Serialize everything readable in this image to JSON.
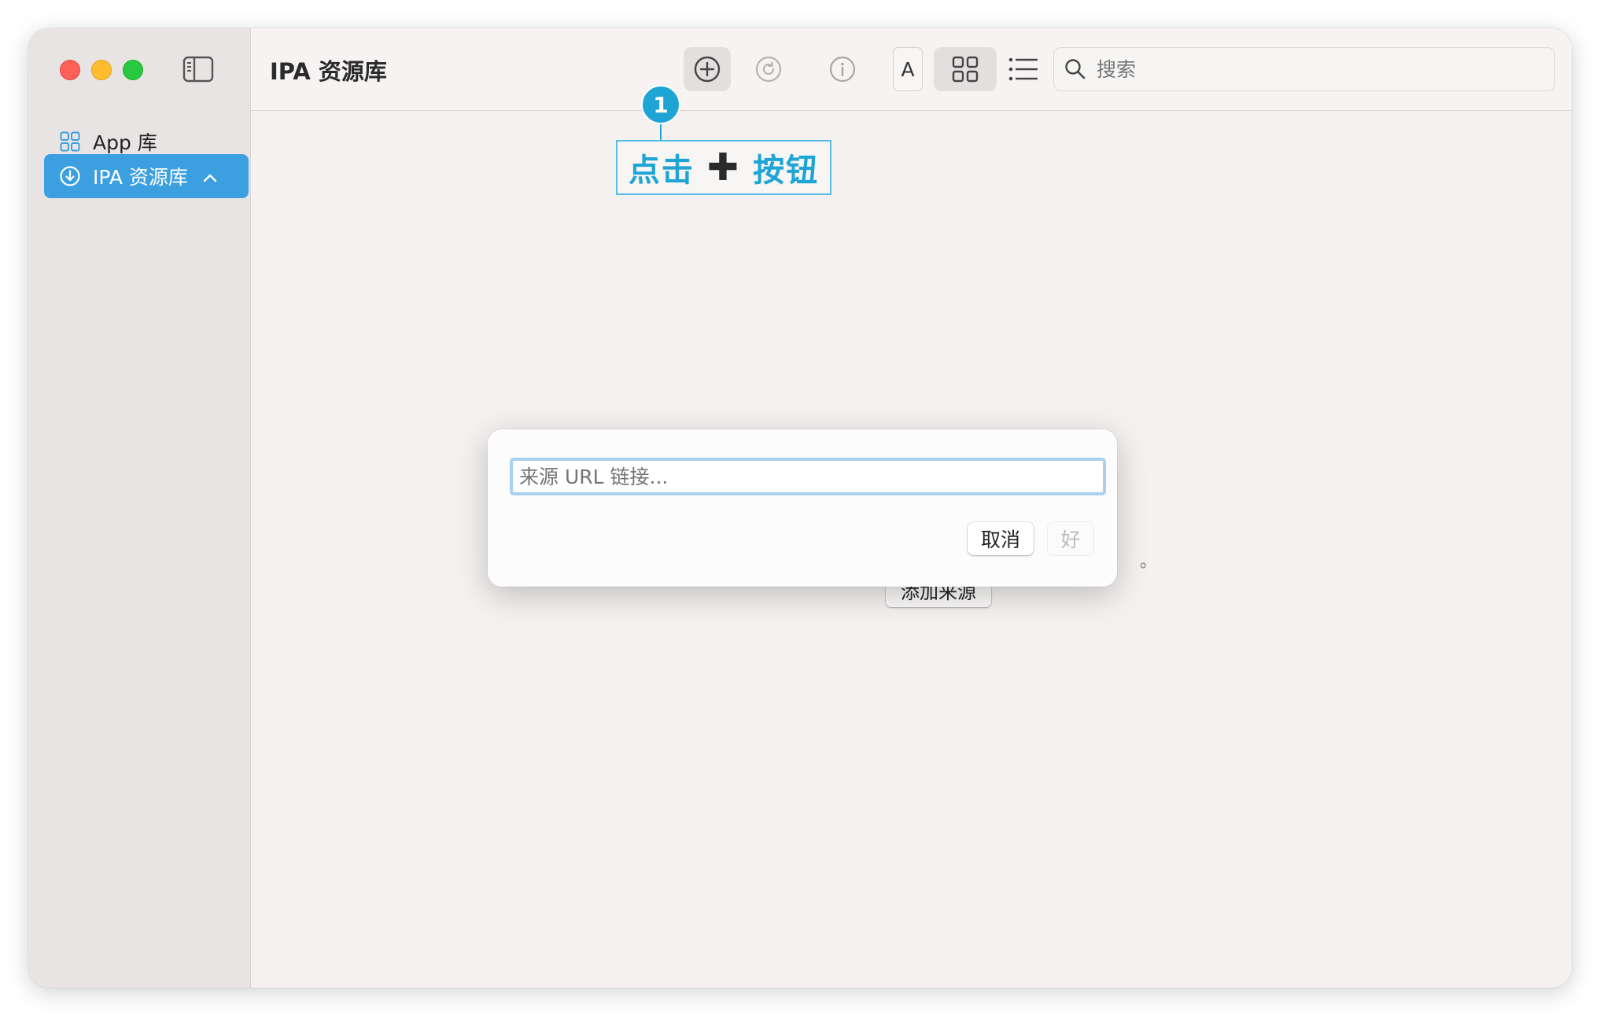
{
  "sidebar": {
    "items": [
      {
        "label": "App 库",
        "icon": "grid-icon",
        "active": false
      },
      {
        "label": "IPA 资源库",
        "icon": "download-circle-icon",
        "active": true
      }
    ]
  },
  "toolbar": {
    "title": "IPA 资源库",
    "font_button_label": "A",
    "search_placeholder": "搜索"
  },
  "annotation": {
    "step_number": "1",
    "text_before": "点击",
    "plus_glyph": "✚",
    "text_after": "按钮",
    "color": "#1ea5d6"
  },
  "dialog": {
    "url_placeholder": "来源 URL 链接...",
    "cancel_label": "取消",
    "ok_label": "好"
  },
  "background": {
    "add_source_label": "添加来源",
    "trailing_punct": "。"
  },
  "colors": {
    "accent": "#3b9fe0",
    "close": "#fe5f57",
    "minimize": "#febc2e",
    "zoom": "#28c840"
  }
}
